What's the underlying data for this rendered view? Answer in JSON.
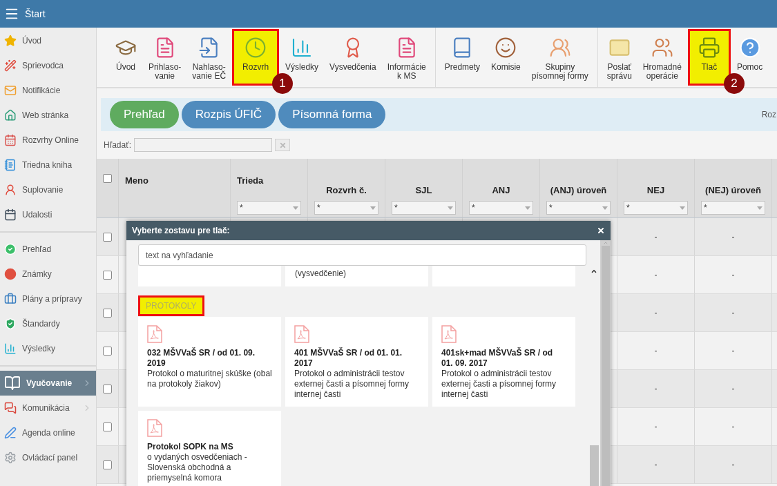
{
  "header": {
    "title": "Štart"
  },
  "sidebar": {
    "groups": [
      {
        "items": [
          {
            "label": "Úvod",
            "selected": false,
            "has_submenu": false
          },
          {
            "label": "Sprievodca",
            "selected": false,
            "has_submenu": false
          },
          {
            "label": "Notifikácie",
            "selected": false,
            "has_submenu": false
          },
          {
            "label": "Web stránka",
            "selected": false,
            "has_submenu": false
          },
          {
            "label": "Rozvrhy Online",
            "selected": false,
            "has_submenu": false
          },
          {
            "label": "Triedna kniha",
            "selected": false,
            "has_submenu": false
          },
          {
            "label": "Suplovanie",
            "selected": false,
            "has_submenu": false
          },
          {
            "label": "Udalosti",
            "selected": false,
            "has_submenu": false
          }
        ]
      },
      {
        "items": [
          {
            "label": "Prehľad",
            "selected": false,
            "has_submenu": false
          },
          {
            "label": "Známky",
            "selected": false,
            "has_submenu": false
          },
          {
            "label": "Plány a prípravy",
            "selected": false,
            "has_submenu": false
          },
          {
            "label": "Štandardy",
            "selected": false,
            "has_submenu": false
          },
          {
            "label": "Výsledky",
            "selected": false,
            "has_submenu": false
          }
        ]
      },
      {
        "items": [
          {
            "label": "Vyučovanie",
            "selected": true,
            "has_submenu": true
          },
          {
            "label": "Komunikácia",
            "selected": false,
            "has_submenu": true
          },
          {
            "label": "Agenda online",
            "selected": false,
            "has_submenu": false
          },
          {
            "label": "Ovládací panel",
            "selected": false,
            "has_submenu": false
          }
        ]
      }
    ]
  },
  "toolbar": {
    "groups": [
      {
        "buttons": [
          {
            "label": "Úvod",
            "highlighted": false
          },
          {
            "label": "Prihlaso-\nvanie",
            "highlighted": false
          },
          {
            "label": "Nahlaso-\nvanie EČ",
            "highlighted": false
          },
          {
            "label": "Rozvrh",
            "highlighted": true,
            "badge": "1"
          },
          {
            "label": "Výsledky",
            "highlighted": false
          },
          {
            "label": "Vysvedčenia",
            "highlighted": false
          },
          {
            "label": "Informácie\nk MS",
            "highlighted": false
          }
        ]
      },
      {
        "buttons": [
          {
            "label": "Predmety",
            "highlighted": false
          },
          {
            "label": "Komisie",
            "highlighted": false
          },
          {
            "label": "Skupiny\npísomnej formy",
            "highlighted": false
          }
        ]
      },
      {
        "buttons": [
          {
            "label": "Poslať\nsprávu",
            "highlighted": false
          },
          {
            "label": "Hromadné\noperácie",
            "highlighted": false
          },
          {
            "label": "Tlač",
            "highlighted": true,
            "badge": "2"
          },
          {
            "label": "Pomoc",
            "highlighted": false
          }
        ]
      }
    ]
  },
  "tabs": {
    "items": [
      {
        "label": "Prehľad",
        "selected": true
      },
      {
        "label": "Rozpis ÚFIČ",
        "selected": false
      },
      {
        "label": "Písomná forma",
        "selected": false
      }
    ],
    "right_text": "Roz"
  },
  "search": {
    "label": "Hľadať:"
  },
  "table": {
    "select_all_checked": false,
    "columns": [
      {
        "label": "Meno",
        "kind": "plain"
      },
      {
        "label": "Trieda",
        "kind": "filter_top",
        "filter": "*"
      },
      {
        "label": "Rozvrh č.",
        "kind": "filter",
        "filter": "*"
      },
      {
        "label": "SJL",
        "kind": "filter",
        "filter": "*"
      },
      {
        "label": "ANJ",
        "kind": "filter",
        "filter": "*"
      },
      {
        "label": "(ANJ) úroveň",
        "kind": "filter",
        "filter": "*"
      },
      {
        "label": "NEJ",
        "kind": "filter",
        "filter": "*"
      },
      {
        "label": "(NEJ) úroveň",
        "kind": "filter",
        "filter": "*"
      }
    ],
    "rows": [
      {
        "checked": false,
        "nej": "-",
        "nej_uroven": "-"
      },
      {
        "checked": false,
        "nej": "-",
        "nej_uroven": "-"
      },
      {
        "checked": false,
        "nej": "-",
        "nej_uroven": "-"
      },
      {
        "checked": false,
        "nej": "-",
        "nej_uroven": "-"
      },
      {
        "checked": false,
        "nej": "-",
        "nej_uroven": "-"
      },
      {
        "checked": false,
        "nej": "-",
        "nej_uroven": "-"
      },
      {
        "checked": false,
        "nej": "-",
        "nej_uroven": "-"
      }
    ]
  },
  "modal": {
    "title": "Vyberte zostavu pre tlač:",
    "search_placeholder": "text na vyhľadanie",
    "cut_off_cards": [
      {
        "kind": "blank"
      },
      {
        "kind": "text",
        "description": "(vysvedčenie)"
      },
      {
        "kind": "blank"
      }
    ],
    "section": {
      "title": "PROTOKOLY",
      "highlighted": true,
      "cards": [
        {
          "title": "032 MŠVVaŠ SR / od 01. 09. 2019",
          "description": "Protokol o maturitnej skúške (obal na protokoly žiakov)"
        },
        {
          "title": "401 MŠVVaŠ SR / od 01. 01. 2017",
          "description": "Protokol o administrácii testov externej časti a písomnej formy internej časti"
        },
        {
          "title": "401sk+mad MŠVVaŠ SR / od 01. 09. 2017",
          "description": "Protokol o administrácii testov externej časti a písomnej formy internej časti"
        },
        {
          "title": "Protokol SOPK na MS",
          "description": "o vydaných osvedčeniach - Slovenská obchodná a priemyselná komora"
        }
      ]
    }
  }
}
